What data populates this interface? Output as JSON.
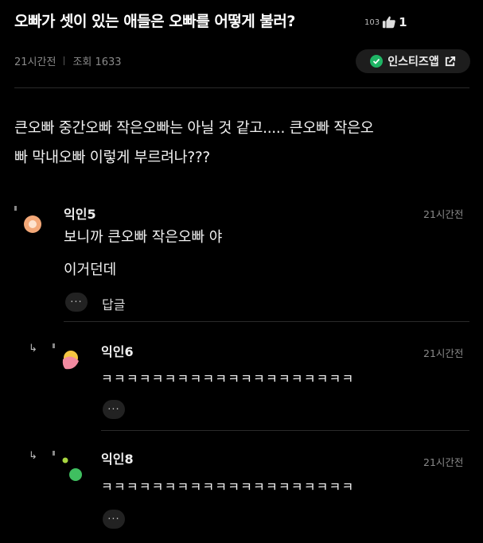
{
  "post": {
    "title": "오빠가 셋이 있는 애들은 오빠를 어떻게 불러?",
    "views_count": "103",
    "likes_count": "1",
    "time": "21시간전",
    "views_label": "조회 1633",
    "app_button": "인스티즈앱",
    "body_line1": "큰오빠 중간오빠 작은오빠는 아닐 것 같고..... 큰오빠 작은오",
    "body_line2": "빠 막내오빠 이렇게 부르려나???"
  },
  "comments": [
    {
      "nick": "익인5",
      "time": "21시간전",
      "line1": "보니까 큰오빠 작은오빠 야",
      "line2": "이거던데",
      "more": "···",
      "reply_label": "답글"
    },
    {
      "nick": "익인6",
      "time": "21시간전",
      "text": "ㅋㅋㅋㅋㅋㅋㅋㅋㅋㅋㅋㅋㅋㅋㅋㅋㅋㅋㅋㅋ",
      "more": "···"
    },
    {
      "nick": "익인8",
      "time": "21시간전",
      "text": "ㅋㅋㅋㅋㅋㅋㅋㅋㅋㅋㅋㅋㅋㅋㅋㅋㅋㅋㅋㅋ",
      "more": "···"
    }
  ],
  "icons": {
    "thumb": "thumbs-up-icon",
    "check": "check-circle-icon",
    "external": "external-link-icon",
    "reply_arrow": "reply-arrow-icon"
  },
  "colors": {
    "background": "#000000",
    "app_check": "#1fb565",
    "avatar5": "#f3a878",
    "avatar6_a": "#f28aa0",
    "avatar6_b": "#f5c542",
    "avatar8_a": "#a8d640",
    "avatar8_b": "#3fbf60"
  }
}
